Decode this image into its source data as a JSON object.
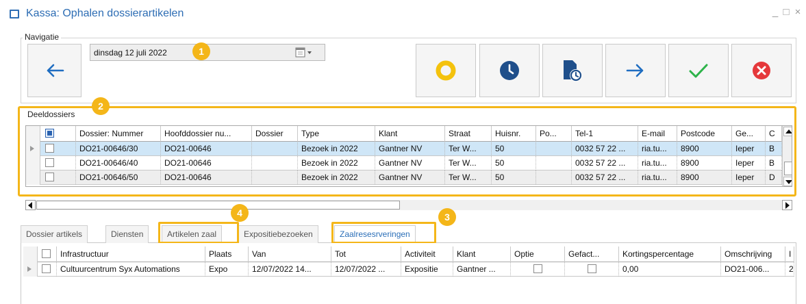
{
  "window": {
    "title": "Kassa: Ophalen dossierartikelen",
    "controls": {
      "minimize": "_",
      "maximize": "□",
      "close": "×"
    }
  },
  "navigation": {
    "legend": "Navigatie",
    "date_value": "dinsdag 12 juli 2022",
    "badge": "1",
    "buttons": [
      {
        "name": "back-button",
        "icon": "arrow-left-icon",
        "color": "#1f6dc1"
      },
      {
        "name": "record-button",
        "icon": "circle-ring-icon",
        "color": "#f4c20d"
      },
      {
        "name": "clock-button",
        "icon": "clock-icon",
        "color": "#1f4f8b"
      },
      {
        "name": "document-clock-button",
        "icon": "document-clock-icon",
        "color": "#1f4f8b"
      },
      {
        "name": "forward-button",
        "icon": "arrow-right-icon",
        "color": "#1f6dc1"
      },
      {
        "name": "confirm-button",
        "icon": "check-icon",
        "color": "#2db34a"
      },
      {
        "name": "cancel-button",
        "icon": "cancel-icon",
        "color": "#e5383b"
      }
    ]
  },
  "deeldossiers": {
    "legend": "Deeldossiers",
    "badge": "2",
    "columns": [
      "Dossier: Nummer",
      "Hoofddossier nu...",
      "Dossier",
      "Type",
      "Klant",
      "Straat",
      "Huisnr.",
      "Po...",
      "Tel-1",
      "E-mail",
      "Postcode",
      "Ge...",
      "C"
    ],
    "rows": [
      [
        "DO21-00646/30",
        "DO21-00646",
        "",
        "Bezoek in 2022",
        "Gantner NV",
        "Ter W...",
        "50",
        "",
        "0032 57 22 ...",
        "ria.tu...",
        "8900",
        "Ieper",
        "B"
      ],
      [
        "DO21-00646/40",
        "DO21-00646",
        "",
        "Bezoek in 2022",
        "Gantner NV",
        "Ter W...",
        "50",
        "",
        "0032 57 22 ...",
        "ria.tu...",
        "8900",
        "Ieper",
        "B"
      ],
      [
        "DO21-00646/50",
        "DO21-00646",
        "",
        "Bezoek in 2022",
        "Gantner NV",
        "Ter W...",
        "50",
        "",
        "0032 57 22 ...",
        "ria.tu...",
        "8900",
        "Ieper",
        "D"
      ]
    ]
  },
  "tabs": {
    "items": [
      "Dossier artikels",
      "Diensten",
      "Artikelen zaal",
      "Expositiebezoeken",
      "Zaalresesrveringen"
    ],
    "active_index": 4,
    "badge_3": "3",
    "badge_4": "4"
  },
  "reservations": {
    "columns": [
      "Infrastructuur",
      "Plaats",
      "Van",
      "Tot",
      "Activiteit",
      "Klant",
      "Optie",
      "Gefact...",
      "Kortingspercentage",
      "Omschrijving",
      "I"
    ],
    "rows": [
      [
        "Cultuurcentrum Syx Automations",
        "Expo",
        "12/07/2022 14...",
        "12/07/2022 ...",
        "Expositie",
        "Gantner ...",
        "",
        "",
        "0,00",
        "DO21-006...",
        "2"
      ]
    ]
  },
  "colors": {
    "accent": "#2d6db4",
    "highlight": "#f4b619",
    "selected_row": "#cfe6f7"
  }
}
